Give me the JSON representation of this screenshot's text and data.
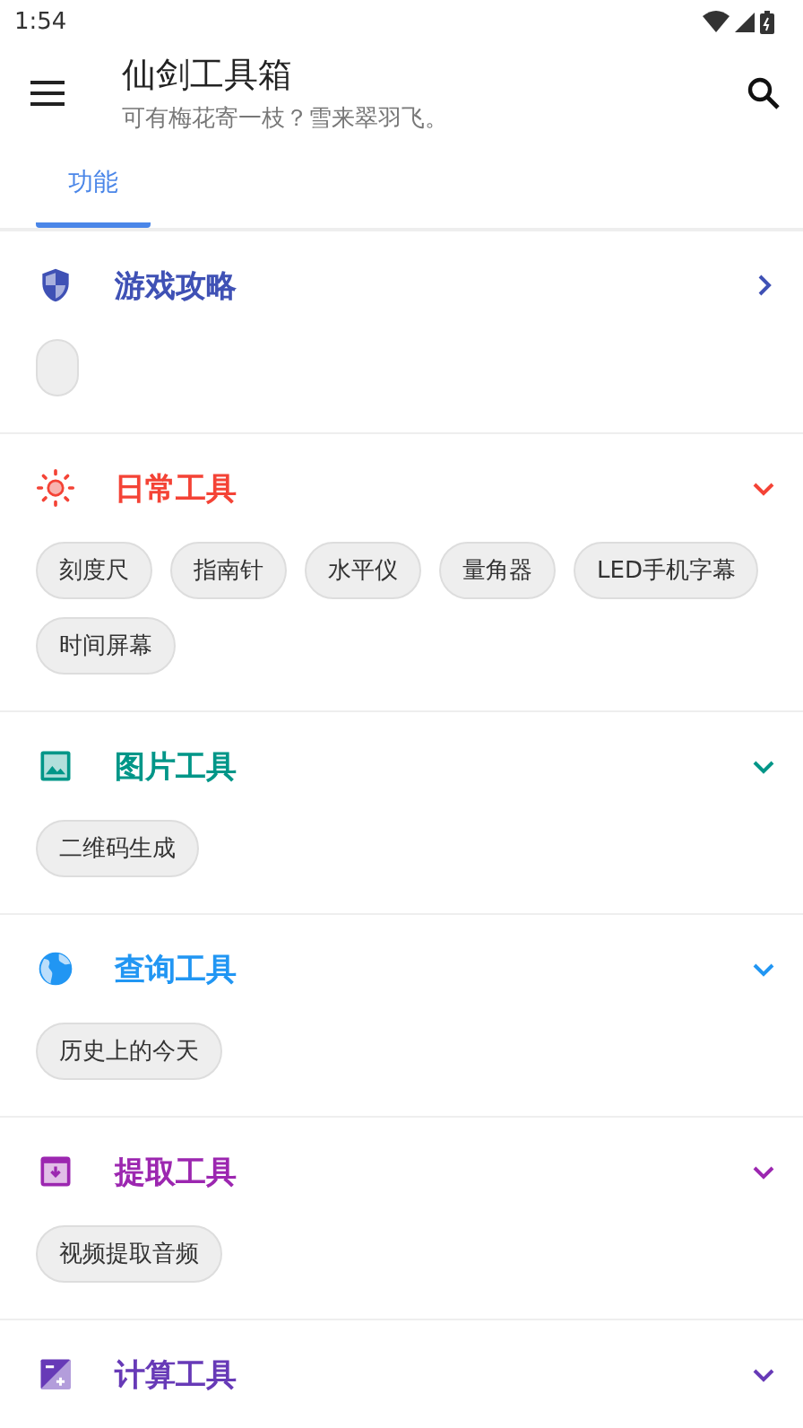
{
  "status_bar": {
    "time": "1:54"
  },
  "app_bar": {
    "title": "仙剑工具箱",
    "subtitle": "可有梅花寄一枝？雪来翠羽飞。"
  },
  "tabs": [
    {
      "label": "功能",
      "selected": true
    }
  ],
  "sections": [
    {
      "kind": "shield",
      "title": "游戏攻略",
      "color": "#3f51b5",
      "expanded": false,
      "blank_chip": true
    },
    {
      "kind": "sun",
      "title": "日常工具",
      "color": "#f44336",
      "expanded": true,
      "chips": [
        "刻度尺",
        "指南针",
        "水平仪",
        "量角器",
        "LED手机字幕",
        "时间屏幕"
      ]
    },
    {
      "kind": "image",
      "title": "图片工具",
      "color": "#009688",
      "expanded": true,
      "chips": [
        "二维码生成"
      ]
    },
    {
      "kind": "globe",
      "title": "查询工具",
      "color": "#2196f3",
      "expanded": true,
      "chips": [
        "历史上的今天"
      ]
    },
    {
      "kind": "archive",
      "title": "提取工具",
      "color": "#9c27b0",
      "expanded": true,
      "chips": [
        "视频提取音频"
      ]
    },
    {
      "kind": "calc",
      "title": "计算工具",
      "color": "#673ab7",
      "expanded": true
    }
  ]
}
